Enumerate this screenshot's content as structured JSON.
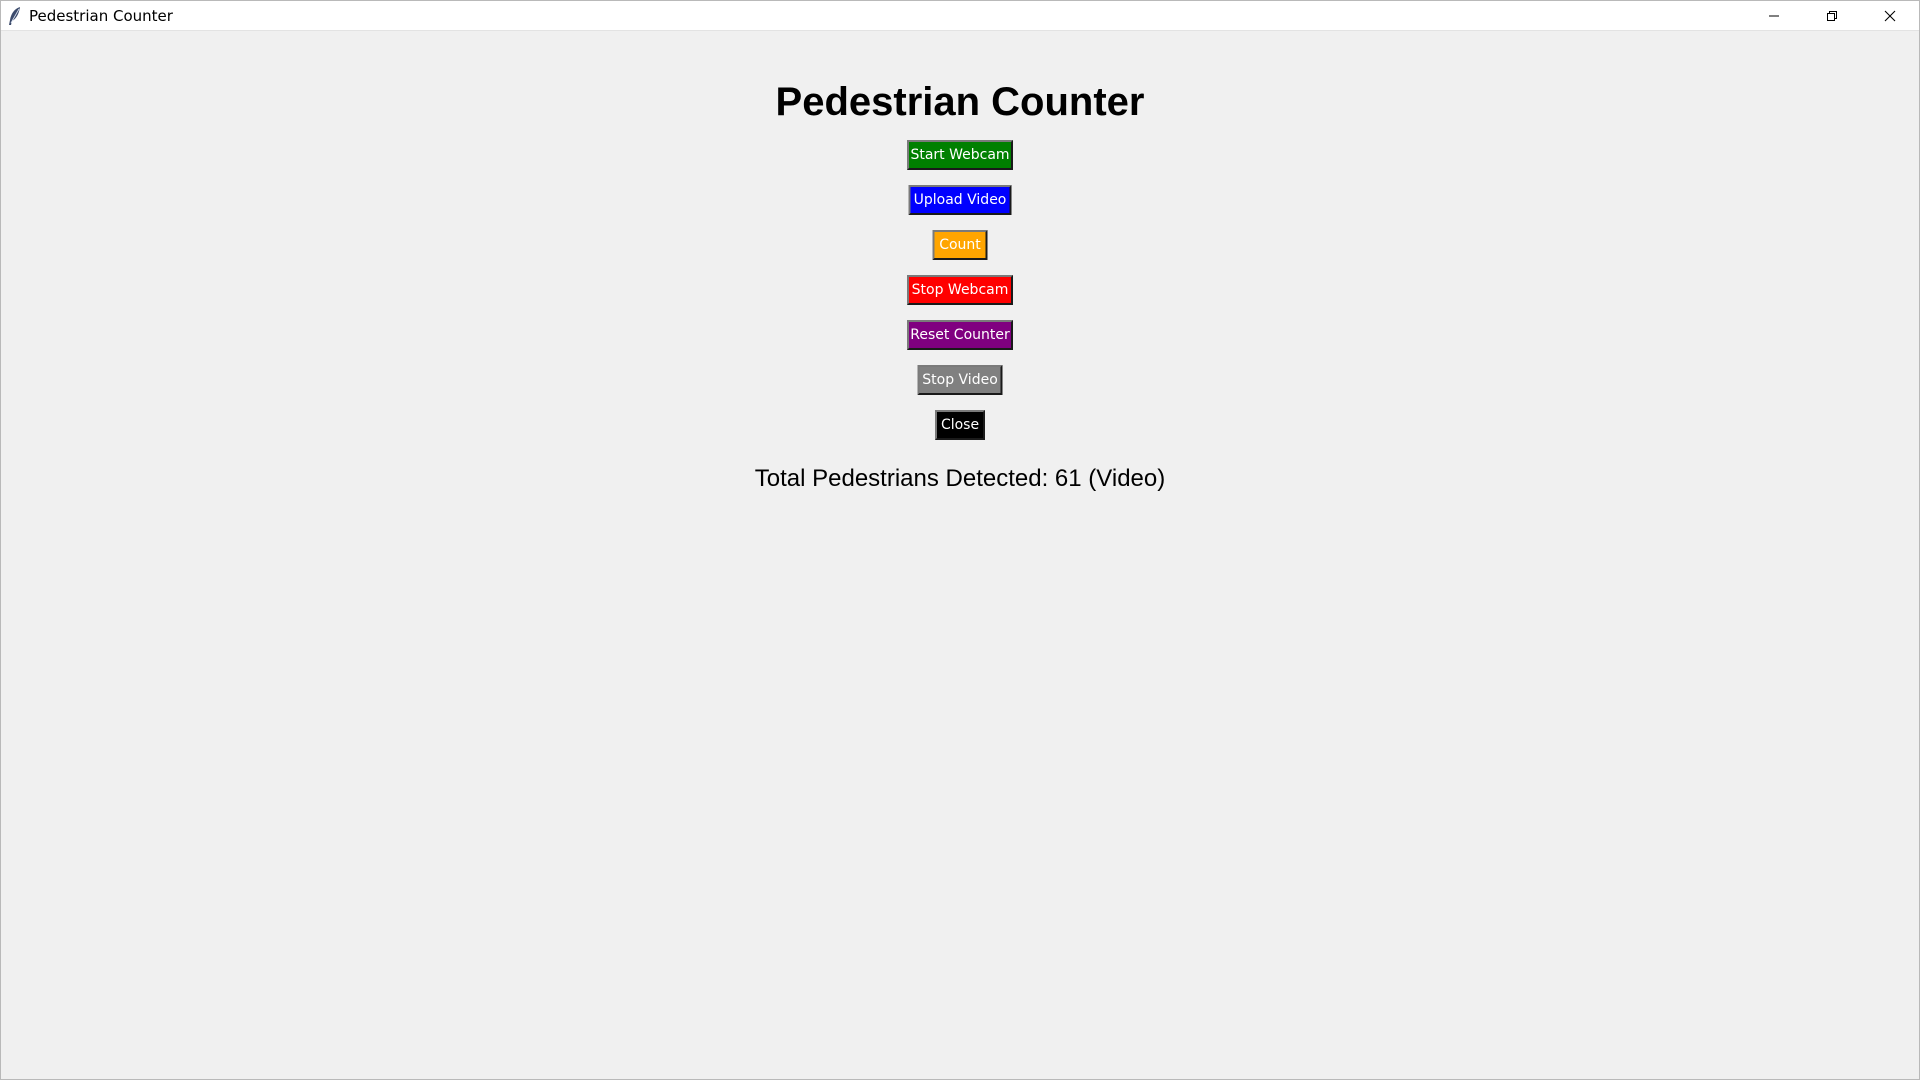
{
  "window": {
    "title": "Pedestrian Counter"
  },
  "titlebar_controls": {
    "minimize_icon": "minimize-icon",
    "restore_icon": "restore-icon",
    "close_icon": "close-icon"
  },
  "main": {
    "heading": "Pedestrian Counter",
    "buttons": [
      {
        "label": "Start Webcam",
        "color": "#008000"
      },
      {
        "label": "Upload Video",
        "color": "#0000ff"
      },
      {
        "label": "Count",
        "color": "#ffa500"
      },
      {
        "label": "Stop Webcam",
        "color": "#ff0000"
      },
      {
        "label": "Reset Counter",
        "color": "#800080"
      },
      {
        "label": "Stop Video",
        "color": "#808080"
      },
      {
        "label": "Close",
        "color": "#000000"
      }
    ],
    "status": "Total Pedestrians Detected: 61 (Video)"
  }
}
